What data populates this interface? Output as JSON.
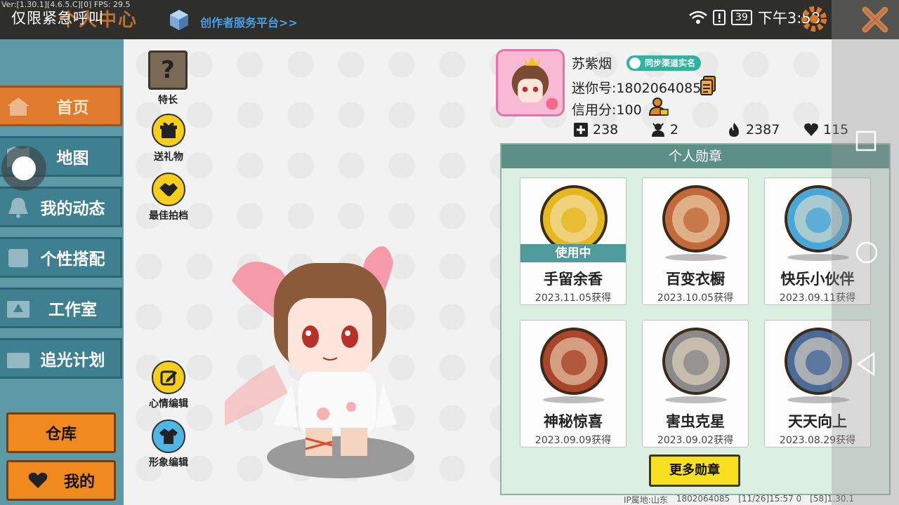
{
  "topbar": {
    "debug": "Ver:[1.30.1][4.6.5.C][0] FPS: 29.5",
    "urgent": "仅限紧急呼叫",
    "title": "个人中心",
    "creator_link": "创作者服务平台>>",
    "battery": "39",
    "time": "下午3:58"
  },
  "nav": {
    "items": [
      {
        "label": "首页",
        "icon": "house-icon"
      },
      {
        "label": "地图",
        "icon": "map-icon"
      },
      {
        "label": "我的动态",
        "icon": "bell-icon"
      },
      {
        "label": "个性搭配",
        "icon": "outfit-icon"
      },
      {
        "label": "工作室",
        "icon": "studio-icon"
      },
      {
        "label": "追光计划",
        "icon": "light-icon"
      }
    ],
    "warehouse": "仓库",
    "mine": "我的"
  },
  "tools": {
    "talent": "特长",
    "gift": "送礼物",
    "best_shot": "最佳拍档",
    "mood_edit": "心情编辑",
    "image_edit": "形象编辑"
  },
  "profile": {
    "name": "苏紫烟",
    "verify": "同步渠道实名",
    "mini_id": "迷你号:1802064085",
    "credit": "信用分:100",
    "stats": {
      "add": "238",
      "fans": "2",
      "fire": "2387",
      "likes": "115"
    }
  },
  "medals": {
    "title": "个人勋章",
    "in_use": "使用中",
    "more": "更多勋章",
    "items": [
      {
        "name": "手留余香",
        "date": "2023.11.05获得",
        "color": "#e6b820"
      },
      {
        "name": "百变衣橱",
        "date": "2023.10.05获得",
        "color": "#c26a3a"
      },
      {
        "name": "快乐小伙伴",
        "date": "2023.09.11获得",
        "color": "#49a6d8"
      },
      {
        "name": "神秘惊喜",
        "date": "2023.09.09获得",
        "color": "#a8452a"
      },
      {
        "name": "害虫克星",
        "date": "2023.09.02获得",
        "color": "#8a8a8a"
      },
      {
        "name": "天天向上",
        "date": "2023.08.29获得",
        "color": "#4a6a98"
      }
    ]
  },
  "bottom": {
    "ip": "IP属地:山东",
    "uid": "1802064085",
    "stamp": "[11/26]15:57 0",
    "ver": "[58]1.30.1"
  }
}
